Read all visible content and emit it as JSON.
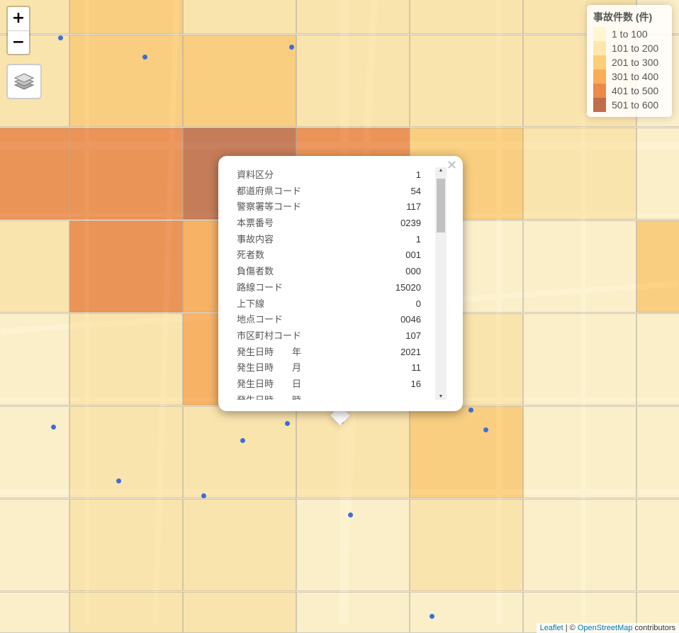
{
  "map": {
    "grid_levels": [
      [
        2,
        3,
        2,
        2,
        2,
        2,
        1
      ],
      [
        2,
        3,
        3,
        2,
        2,
        2,
        1
      ],
      [
        5,
        5,
        6,
        5,
        3,
        2,
        1
      ],
      [
        2,
        5,
        4,
        4,
        1,
        1,
        3
      ],
      [
        1,
        2,
        4,
        3,
        2,
        1,
        1
      ],
      [
        1,
        2,
        2,
        2,
        3,
        1,
        1
      ],
      [
        1,
        2,
        2,
        1,
        2,
        1,
        1
      ],
      [
        1,
        2,
        2,
        1,
        1,
        1,
        1
      ]
    ]
  },
  "controls": {
    "zoom_in": "+",
    "zoom_out": "−",
    "layers_icon": "layers-icon"
  },
  "legend": {
    "title": "事故件数 (件)",
    "items": [
      {
        "label": "1 to 100",
        "color": "#fff3c8"
      },
      {
        "label": "101 to 200",
        "color": "#fee3a0"
      },
      {
        "label": "201 to 300",
        "color": "#fdc561"
      },
      {
        "label": "301 to 400",
        "color": "#f99e3c"
      },
      {
        "label": "401 to 500",
        "color": "#e8752a"
      },
      {
        "label": "501 to 600",
        "color": "#b5532a"
      }
    ]
  },
  "popup": {
    "close": "×",
    "rows": [
      {
        "k": "資料区分",
        "v": "1"
      },
      {
        "k": "都道府県コード",
        "v": "54"
      },
      {
        "k": "警察署等コード",
        "v": "117"
      },
      {
        "k": "本票番号",
        "v": "0239"
      },
      {
        "k": "事故内容",
        "v": "1"
      },
      {
        "k": "死者数",
        "v": "001"
      },
      {
        "k": "負傷者数",
        "v": "000"
      },
      {
        "k": "路線コード",
        "v": "15020"
      },
      {
        "k": "上下線",
        "v": "0"
      },
      {
        "k": "地点コード",
        "v": "0046"
      },
      {
        "k": "市区町村コード",
        "v": "107"
      },
      {
        "k": "発生日時　　年",
        "v": "2021"
      },
      {
        "k": "発生日時　　月",
        "v": "11"
      },
      {
        "k": "発生日時　　日",
        "v": "16"
      },
      {
        "k": "発生日時　　時",
        "v": ""
      }
    ]
  },
  "attribution": {
    "leaflet": "Leaflet",
    "sep": " | © ",
    "osm": "OpenStreetMap",
    "tail": " contributors"
  }
}
